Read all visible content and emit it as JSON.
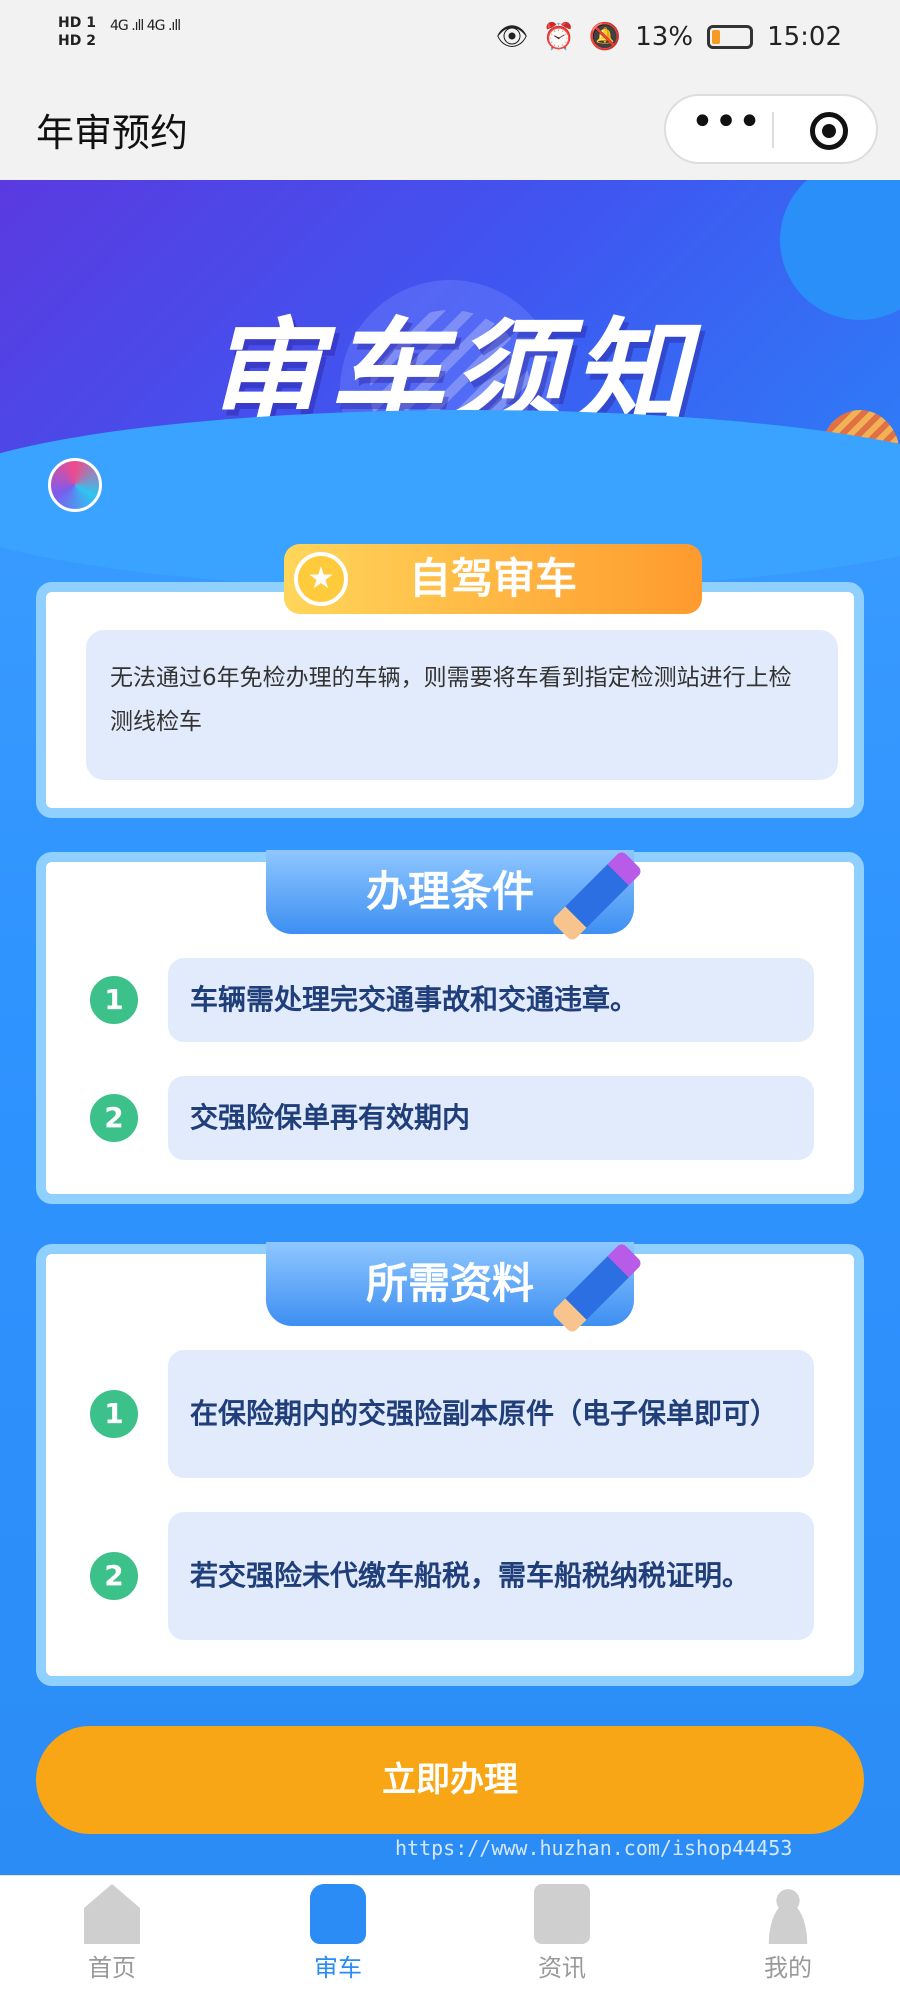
{
  "status_bar": {
    "hd1": "HD 1",
    "hd2": "HD 2",
    "signal": "4G .ıll 4G .ıll",
    "battery": "13%",
    "time": "15:02"
  },
  "header": {
    "title": "年审预约",
    "more_icon": "more-dots-icon",
    "target_icon": "record-target-icon"
  },
  "banner": {
    "title": "审车须知"
  },
  "section1": {
    "tag": "自驾审车",
    "text": "无法通过6年免检办理的车辆，则需要将车看到指定检测站进行上检测线检车"
  },
  "section2": {
    "title": "办理条件",
    "items": [
      {
        "num": "1",
        "text": "车辆需处理完交通事故和交通违章。"
      },
      {
        "num": "2",
        "text": "交强险保单再有效期内"
      }
    ]
  },
  "section3": {
    "title": "所需资料",
    "items": [
      {
        "num": "1",
        "text": "在保险期内的交强险副本原件（电子保单即可）"
      },
      {
        "num": "2",
        "text": "若交强险未代缴车船税，需车船税纳税证明。"
      }
    ]
  },
  "cta": {
    "label": "立即办理"
  },
  "watermark": "https://www.huzhan.com/ishop44453",
  "tabbar": {
    "items": [
      {
        "label": "首页",
        "icon": "home-icon"
      },
      {
        "label": "审车",
        "icon": "car-icon"
      },
      {
        "label": "资讯",
        "icon": "news-icon"
      },
      {
        "label": "我的",
        "icon": "user-icon"
      }
    ],
    "active_color": "#2b8cf5"
  }
}
